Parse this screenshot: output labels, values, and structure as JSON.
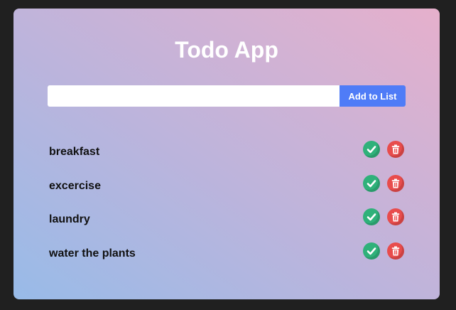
{
  "app": {
    "title": "Todo App"
  },
  "add_form": {
    "input_value": "",
    "input_placeholder": "",
    "add_label": "Add to List"
  },
  "todos": [
    {
      "text": "breakfast"
    },
    {
      "text": "excercise"
    },
    {
      "text": "laundry"
    },
    {
      "text": "water the plants"
    }
  ],
  "icons": {
    "complete": "check-icon",
    "delete": "trash-icon"
  },
  "colors": {
    "accent_button": "#4f7cf7",
    "complete": "#2fb17a",
    "delete": "#e84c4c",
    "title_text": "#ffffff",
    "item_text": "#111111"
  }
}
